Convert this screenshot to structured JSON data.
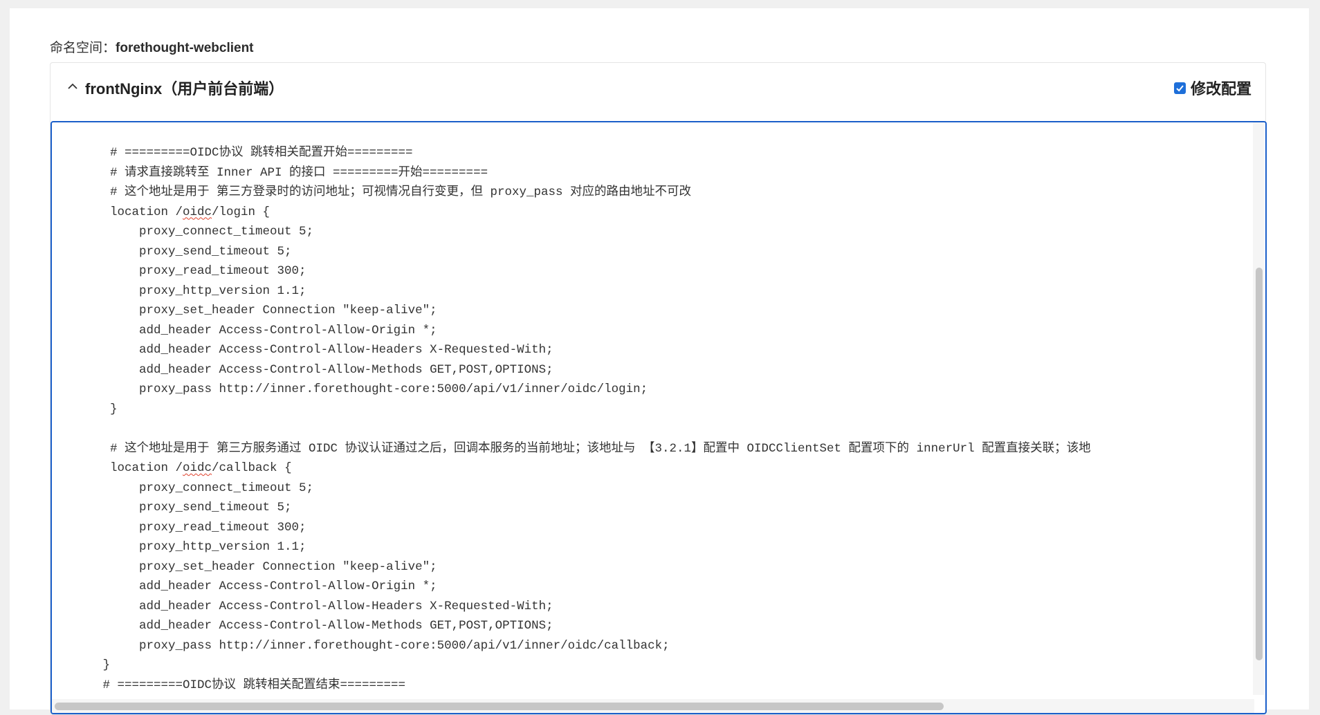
{
  "namespace": {
    "label": "命名空间：",
    "value": "forethought-webclient"
  },
  "card": {
    "title": "frontNginx（用户前台前端）",
    "modify_label": "修改配置",
    "modify_checked": true
  },
  "editor": {
    "lines": [
      "        # =========OIDC协议 跳转相关配置开始=========",
      "        # 请求直接跳转至 Inner API 的接口 =========开始=========",
      "        # 这个地址是用于 第三方登录时的访问地址；可视情况自行变更，但 proxy_pass 对应的路由地址不可改",
      "        location /oidc/login {",
      "            proxy_connect_timeout 5;",
      "            proxy_send_timeout 5;",
      "            proxy_read_timeout 300;",
      "            proxy_http_version 1.1;",
      "            proxy_set_header Connection \"keep-alive\";",
      "            add_header Access-Control-Allow-Origin *;",
      "            add_header Access-Control-Allow-Headers X-Requested-With;",
      "            add_header Access-Control-Allow-Methods GET,POST,OPTIONS;",
      "            proxy_pass http://inner.forethought-core:5000/api/v1/inner/oidc/login;",
      "        }",
      "",
      "        # 这个地址是用于 第三方服务通过 OIDC 协议认证通过之后，回调本服务的当前地址；该地址与 【3.2.1】配置中 OIDCClientSet 配置项下的 innerUrl 配置直接关联；该地",
      "        location /oidc/callback {",
      "            proxy_connect_timeout 5;",
      "            proxy_send_timeout 5;",
      "            proxy_read_timeout 300;",
      "            proxy_http_version 1.1;",
      "            proxy_set_header Connection \"keep-alive\";",
      "            add_header Access-Control-Allow-Origin *;",
      "            add_header Access-Control-Allow-Headers X-Requested-With;",
      "            add_header Access-Control-Allow-Methods GET,POST,OPTIONS;",
      "            proxy_pass http://inner.forethought-core:5000/api/v1/inner/oidc/callback;",
      "       }",
      "       # =========OIDC协议 跳转相关配置结束========="
    ]
  }
}
